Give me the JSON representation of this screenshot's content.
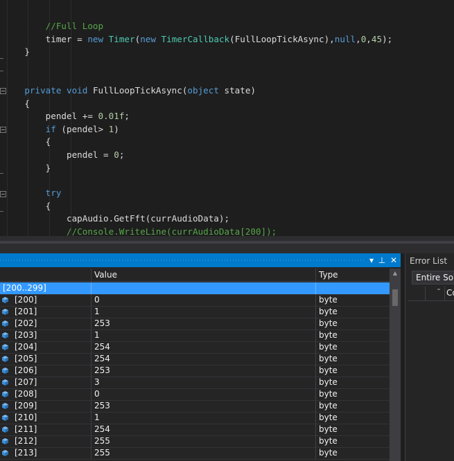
{
  "editor": {
    "lines": [
      [
        {
          "t": "        ",
          "c": "plain"
        }
      ],
      [
        {
          "t": "        ",
          "c": "plain"
        }
      ],
      [
        {
          "t": "        //Full Loop",
          "c": "comment"
        }
      ],
      [
        {
          "t": "        timer = ",
          "c": "plain"
        },
        {
          "t": "new ",
          "c": "kw"
        },
        {
          "t": "Timer",
          "c": "type"
        },
        {
          "t": "(",
          "c": "plain"
        },
        {
          "t": "new ",
          "c": "kw"
        },
        {
          "t": "TimerCallback",
          "c": "type"
        },
        {
          "t": "(FullLoopTickAsync),",
          "c": "plain"
        },
        {
          "t": "null",
          "c": "kw"
        },
        {
          "t": ",",
          "c": "plain"
        },
        {
          "t": "0",
          "c": "num"
        },
        {
          "t": ",",
          "c": "plain"
        },
        {
          "t": "45",
          "c": "num"
        },
        {
          "t": ");",
          "c": "plain"
        }
      ],
      [
        {
          "t": "    }",
          "c": "plain"
        }
      ],
      [
        {
          "t": "",
          "c": "plain"
        }
      ],
      [
        {
          "t": "",
          "c": "plain"
        }
      ],
      [
        {
          "t": "    ",
          "c": "plain"
        },
        {
          "t": "private ",
          "c": "kw"
        },
        {
          "t": "void ",
          "c": "kw"
        },
        {
          "t": "FullLoopTickAsync(",
          "c": "plain"
        },
        {
          "t": "object ",
          "c": "kw"
        },
        {
          "t": "state)",
          "c": "plain"
        }
      ],
      [
        {
          "t": "    {",
          "c": "plain"
        }
      ],
      [
        {
          "t": "        pendel += ",
          "c": "plain"
        },
        {
          "t": "0.01f",
          "c": "num"
        },
        {
          "t": ";",
          "c": "plain"
        }
      ],
      [
        {
          "t": "        ",
          "c": "plain"
        },
        {
          "t": "if ",
          "c": "kw"
        },
        {
          "t": "(pendel> ",
          "c": "plain"
        },
        {
          "t": "1",
          "c": "num"
        },
        {
          "t": ")",
          "c": "plain"
        }
      ],
      [
        {
          "t": "        {",
          "c": "plain"
        }
      ],
      [
        {
          "t": "            pendel = ",
          "c": "plain"
        },
        {
          "t": "0",
          "c": "num"
        },
        {
          "t": ";",
          "c": "plain"
        }
      ],
      [
        {
          "t": "        }",
          "c": "plain"
        }
      ],
      [
        {
          "t": "",
          "c": "plain"
        }
      ],
      [
        {
          "t": "        ",
          "c": "plain"
        },
        {
          "t": "try",
          "c": "kw"
        }
      ],
      [
        {
          "t": "        {",
          "c": "plain"
        }
      ],
      [
        {
          "t": "            capAudio.GetFft(currAudioData);",
          "c": "plain"
        }
      ],
      [
        {
          "t": "            //Console.WriteLine(currAudioData[200]);",
          "c": "comment"
        }
      ]
    ]
  },
  "locals": {
    "columns": {
      "name": "",
      "value": "Value",
      "type": "Type"
    },
    "group_label": "[200..299]",
    "rows": [
      {
        "name": "[200]",
        "value": "0",
        "type": "byte"
      },
      {
        "name": "[201]",
        "value": "1",
        "type": "byte"
      },
      {
        "name": "[202]",
        "value": "253",
        "type": "byte"
      },
      {
        "name": "[203]",
        "value": "1",
        "type": "byte"
      },
      {
        "name": "[204]",
        "value": "254",
        "type": "byte"
      },
      {
        "name": "[205]",
        "value": "254",
        "type": "byte"
      },
      {
        "name": "[206]",
        "value": "253",
        "type": "byte"
      },
      {
        "name": "[207]",
        "value": "3",
        "type": "byte"
      },
      {
        "name": "[208]",
        "value": "0",
        "type": "byte"
      },
      {
        "name": "[209]",
        "value": "253",
        "type": "byte"
      },
      {
        "name": "[210]",
        "value": "1",
        "type": "byte"
      },
      {
        "name": "[211]",
        "value": "254",
        "type": "byte"
      },
      {
        "name": "[212]",
        "value": "255",
        "type": "byte"
      },
      {
        "name": "[213]",
        "value": "255",
        "type": "byte"
      }
    ],
    "toolbar": {
      "dropdown_glyph": "▾",
      "pin_glyph": "⊥",
      "close_glyph": "✕"
    }
  },
  "error_list": {
    "title": "Error List",
    "scope": "Entire Solution",
    "col_code_fragment": "Co",
    "sort_glyph": "⁼"
  },
  "colors": {
    "accent": "#007acc",
    "selection": "#3399ff",
    "cube_icon": "#3c8fd6"
  }
}
